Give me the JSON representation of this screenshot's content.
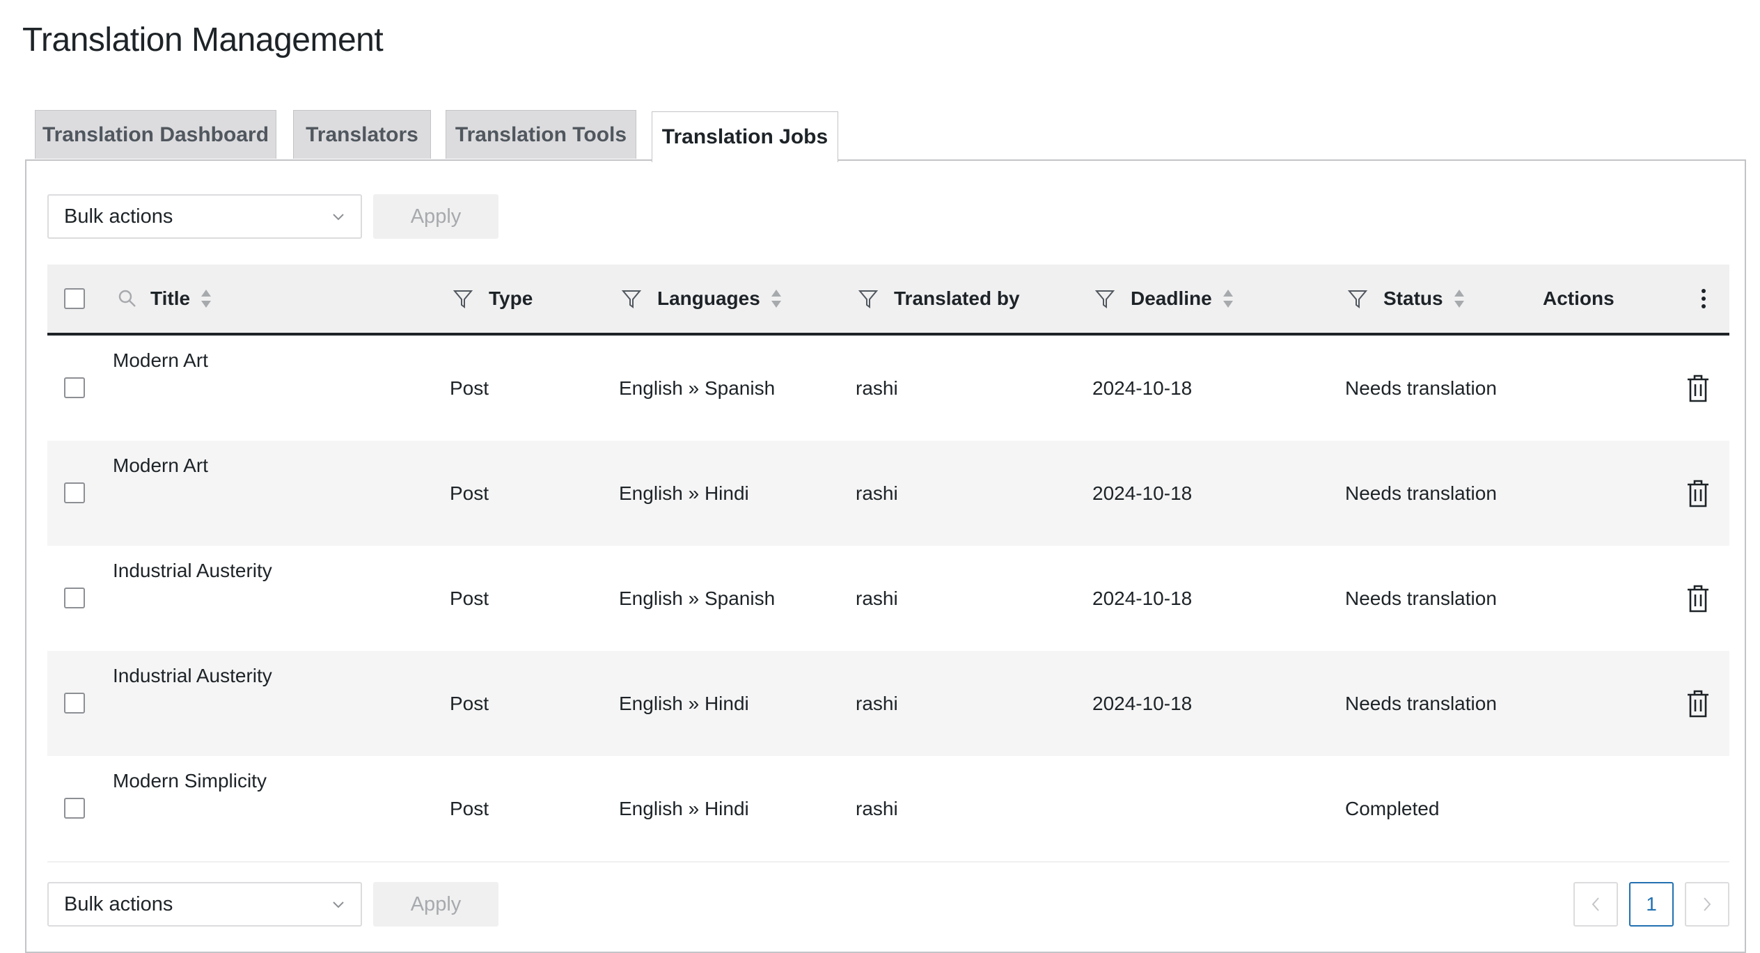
{
  "page": {
    "title": "Translation Management"
  },
  "tabs": [
    {
      "label": "Translation Dashboard",
      "active": false
    },
    {
      "label": "Translators",
      "active": false
    },
    {
      "label": "Translation Tools",
      "active": false
    },
    {
      "label": "Translation Jobs",
      "active": true
    }
  ],
  "bulk": {
    "top": {
      "select": "Bulk actions",
      "apply": "Apply"
    },
    "bottom": {
      "select": "Bulk actions",
      "apply": "Apply"
    }
  },
  "columns": {
    "title": "Title",
    "type": "Type",
    "languages": "Languages",
    "translated_by": "Translated by",
    "deadline": "Deadline",
    "status": "Status",
    "actions": "Actions"
  },
  "rows": [
    {
      "title": "Modern Art",
      "type": "Post",
      "languages": "English » Spanish",
      "translated_by": "rashi",
      "deadline": "2024-10-18",
      "status": "Needs translation",
      "deletable": true
    },
    {
      "title": "Modern Art",
      "type": "Post",
      "languages": "English » Hindi",
      "translated_by": "rashi",
      "deadline": "2024-10-18",
      "status": "Needs translation",
      "deletable": true
    },
    {
      "title": "Industrial Austerity",
      "type": "Post",
      "languages": "English » Spanish",
      "translated_by": "rashi",
      "deadline": "2024-10-18",
      "status": "Needs translation",
      "deletable": true
    },
    {
      "title": "Industrial Austerity",
      "type": "Post",
      "languages": "English » Hindi",
      "translated_by": "rashi",
      "deadline": "2024-10-18",
      "status": "Needs translation",
      "deletable": true
    },
    {
      "title": "Modern Simplicity",
      "type": "Post",
      "languages": "English » Hindi",
      "translated_by": "rashi",
      "deadline": "",
      "status": "Completed",
      "deletable": false
    }
  ],
  "pagination": {
    "current_page": "1"
  },
  "icons": {
    "search": "search-icon",
    "sort": "sort-arrows-icon",
    "filter": "filter-icon",
    "more": "more-vertical-icon",
    "delete": "trash-icon",
    "chevron": "chevron-down-icon",
    "prev": "chevron-left-icon",
    "next": "chevron-right-icon"
  },
  "colors": {
    "accent": "#2271b1",
    "header_bg": "#f0f0f1",
    "alt_row_bg": "#f5f5f5",
    "text": "#1d2327"
  }
}
